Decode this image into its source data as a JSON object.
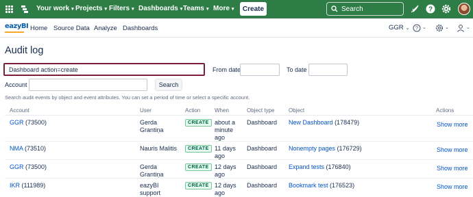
{
  "topbar": {
    "nav": [
      {
        "label": "Your work"
      },
      {
        "label": "Projects"
      },
      {
        "label": "Filters"
      },
      {
        "label": "Dashboards"
      },
      {
        "label": "Teams"
      },
      {
        "label": "More"
      }
    ],
    "create_label": "Create",
    "search_placeholder": "Search",
    "icons": [
      "apps-grid-icon",
      "jira-logo-icon",
      "search-icon",
      "notification-icon",
      "help-icon",
      "settings-icon",
      "user-avatar"
    ],
    "color": "#2e7d46"
  },
  "subbar": {
    "logo": "eazyBI",
    "links": [
      "Home",
      "Source Data",
      "Analyze",
      "Dashboards"
    ],
    "account": "GGR"
  },
  "page": {
    "title": "Audit log"
  },
  "filter": {
    "query_value": "Dashboard action=create",
    "from_date_label": "From date",
    "to_date_label": "To date",
    "account_label": "Account",
    "search_label": "Search",
    "hint": "Search audit events by object and event attributes. You can set a period of time or select a specific account."
  },
  "table": {
    "headers": [
      "Account",
      "User",
      "Action",
      "When",
      "Object type",
      "Object",
      "Actions"
    ],
    "rows": [
      {
        "account_name": "GGR",
        "account_id": "(73500)",
        "user": [
          "Gerda",
          "Grantiņa"
        ],
        "action": "CREATE",
        "when": [
          "about a",
          "minute",
          "ago"
        ],
        "object_type": "Dashboard",
        "object_name": "New Dashboard",
        "object_id": "(178479)",
        "actions": "Show more"
      },
      {
        "account_name": "NMA",
        "account_id": "(73510)",
        "user": [
          "Nauris Malitis"
        ],
        "action": "CREATE",
        "when": [
          "11 days",
          "ago"
        ],
        "object_type": "Dashboard",
        "object_name": "Nonempty pages",
        "object_id": "(176729)",
        "actions": "Show more"
      },
      {
        "account_name": "GGR",
        "account_id": "(73500)",
        "user": [
          "Gerda",
          "Grantiņa"
        ],
        "action": "CREATE",
        "when": [
          "12 days",
          "ago"
        ],
        "object_type": "Dashboard",
        "object_name": "Expand tests",
        "object_id": "(176840)",
        "actions": "Show more"
      },
      {
        "account_name": "IKR",
        "account_id": "(111989)",
        "user": [
          "eazyBI",
          "support"
        ],
        "action": "CREATE",
        "when": [
          "12 days",
          "ago"
        ],
        "object_type": "Dashboard",
        "object_name": "Bookmark test",
        "object_id": "(176523)",
        "actions": "Show more"
      }
    ]
  }
}
